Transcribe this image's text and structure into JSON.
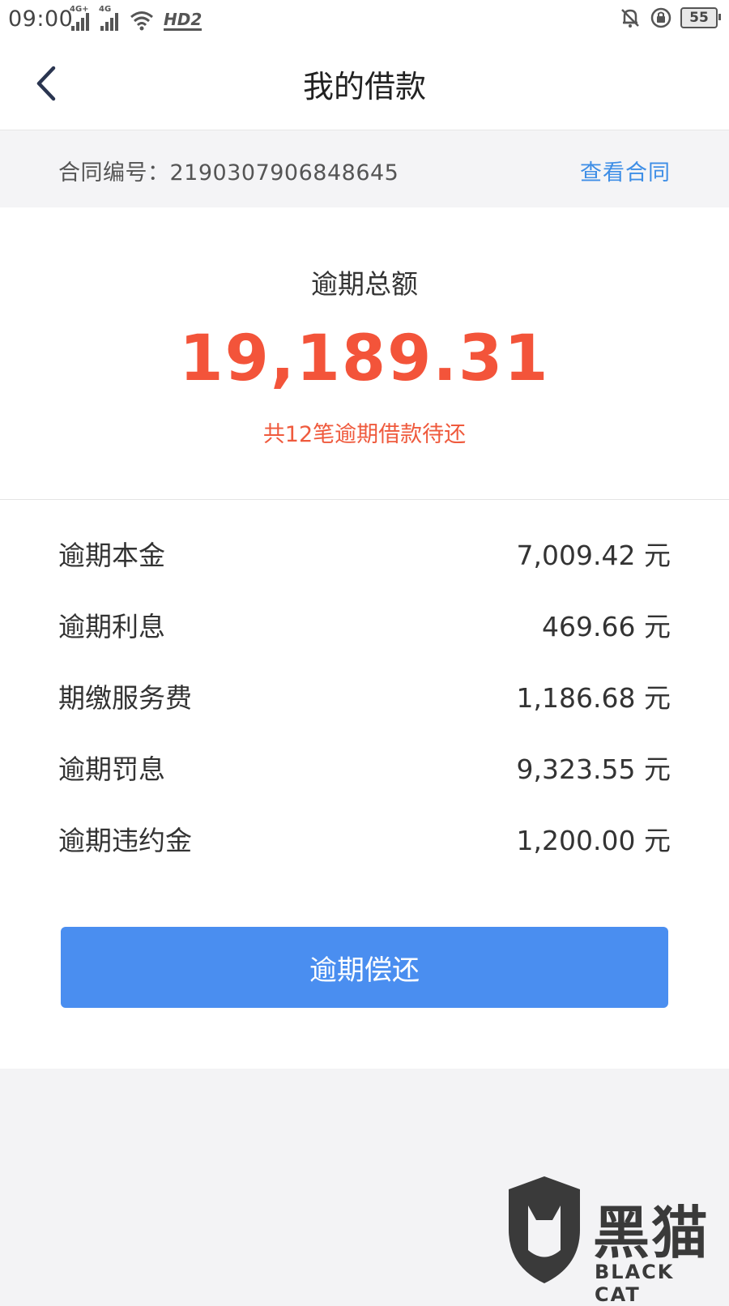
{
  "status_bar": {
    "time": "09:00",
    "signal_1_label": "4G+",
    "signal_2_label": "4G",
    "hd_label": "HD2",
    "battery": "55"
  },
  "nav": {
    "title": "我的借款"
  },
  "contract": {
    "label": "合同编号：2190307906848645",
    "link": "查看合同"
  },
  "summary": {
    "label": "逾期总额",
    "amount": "19,189.31",
    "note": "共12笔逾期借款待还"
  },
  "details": [
    {
      "label": "逾期本金",
      "value": "7,009.42 元"
    },
    {
      "label": "逾期利息",
      "value": "469.66 元"
    },
    {
      "label": "期缴服务费",
      "value": "1,186.68 元"
    },
    {
      "label": "逾期罚息",
      "value": "9,323.55 元"
    },
    {
      "label": "逾期违约金",
      "value": "1,200.00 元"
    }
  ],
  "pay_button": "逾期偿还",
  "watermark": {
    "text": "黑猫",
    "sub": "BLACK CAT"
  },
  "colors": {
    "accent_blue": "#4a8ef0",
    "link_blue": "#3e8ee6",
    "amount_red": "#f3543a"
  }
}
